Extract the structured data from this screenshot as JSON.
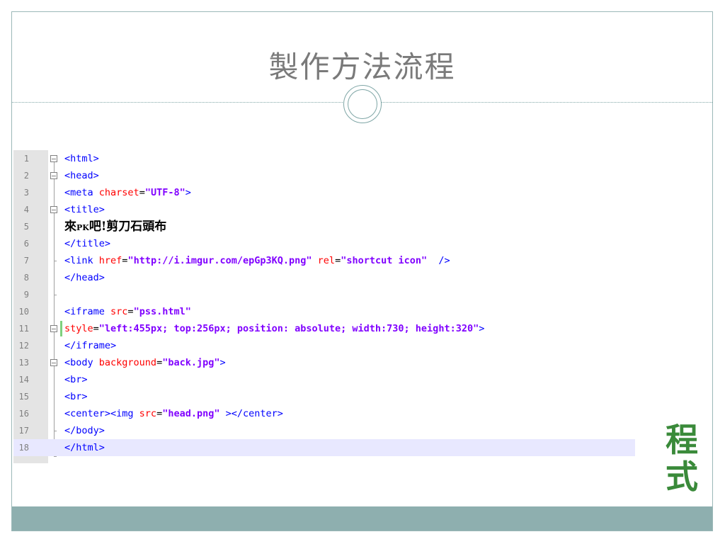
{
  "slide": {
    "title": "製作方法流程",
    "side_label_line1": "程",
    "side_label_line2": "式"
  },
  "editor": {
    "current_line": 18,
    "lines": [
      {
        "n": "1"
      },
      {
        "n": "2"
      },
      {
        "n": "3"
      },
      {
        "n": "4"
      },
      {
        "n": "5"
      },
      {
        "n": "6"
      },
      {
        "n": "7"
      },
      {
        "n": "8"
      },
      {
        "n": "9"
      },
      {
        "n": "10"
      },
      {
        "n": "11"
      },
      {
        "n": "12"
      },
      {
        "n": "13"
      },
      {
        "n": "14"
      },
      {
        "n": "15"
      },
      {
        "n": "16"
      },
      {
        "n": "17"
      },
      {
        "n": "18"
      }
    ],
    "code": {
      "l1_tag": "<html>",
      "l2_tag": "<head>",
      "l3_tag_open": "<meta ",
      "l3_attr": "charset",
      "l3_eq": "=",
      "l3_val": "\"UTF-8\"",
      "l3_tag_close": ">",
      "l4_tag": "<title>",
      "l5_text_a": "來",
      "l5_text_pk": "PK",
      "l5_text_b": "吧!剪刀石頭布",
      "l6_tag": "</title>",
      "l7_tag_open": "<link ",
      "l7_attr1": "href",
      "l7_eq1": "=",
      "l7_val1": "\"http://i.imgur.com/epGp3KQ.png\"",
      "l7_space": " ",
      "l7_attr2": "rel",
      "l7_eq2": "=",
      "l7_val2": "\"shortcut icon\"",
      "l7_tag_close": "  />",
      "l8_tag": "</head>",
      "l10_tag_open": "<iframe ",
      "l10_attr": "src",
      "l10_eq": "=",
      "l10_val": "\"pss.html\"",
      "l11_attr": "style",
      "l11_eq": "=",
      "l11_val": "\"left:455px; top:256px; position: absolute; width:730; height:320\"",
      "l11_tag_close": ">",
      "l12_tag": "</iframe>",
      "l13_tag_open": "<body ",
      "l13_attr": "background",
      "l13_eq": "=",
      "l13_val": "\"back.jpg\"",
      "l13_tag_close": ">",
      "l14_tag": "<br>",
      "l15_tag": "<br>",
      "l16_tag_open": "<center><img ",
      "l16_attr": "src",
      "l16_eq": "=",
      "l16_val": "\"head.png\"",
      "l16_tag_close": " ></center>",
      "l17_tag": "</body>",
      "l18_tag": "</html>"
    }
  },
  "colors": {
    "tag": "#0000ff",
    "attribute": "#ff0000",
    "string": "#8000ff",
    "footer_bar": "#8eafaf",
    "side_label": "#3a8a3a"
  }
}
